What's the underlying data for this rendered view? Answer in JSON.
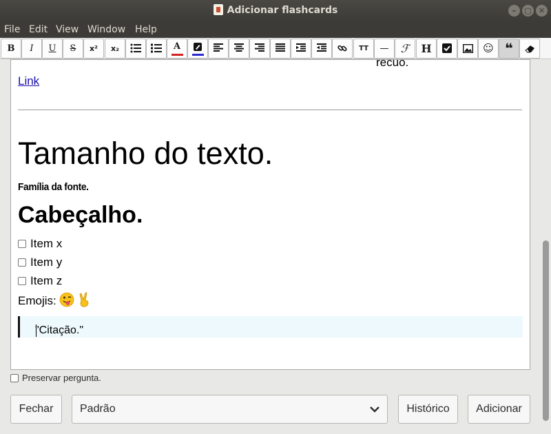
{
  "window": {
    "title": "Adicionar flashcards"
  },
  "menu": [
    "File",
    "Edit",
    "View",
    "Window",
    "Help"
  ],
  "toolbar": {
    "bold": "B",
    "italic": "I",
    "underline": "U",
    "strike": "S",
    "superscript": "x²",
    "subscript": "x₂",
    "text_color": "A",
    "heading": "H",
    "font_size": "TT",
    "hr": "—",
    "quote": "❝"
  },
  "editor": {
    "recuo_text": "recuo.",
    "link_text": "Link",
    "big_text": "Tamanho do texto.",
    "font_family_text": "Família da fonte.",
    "heading_text": "Cabeçalho.",
    "checklist": [
      "Item x",
      "Item y",
      "Item z"
    ],
    "emojis_label": "Emojis:",
    "quote_text": "\"Citação.\""
  },
  "footer": {
    "preserve_label": "Preservar pergunta.",
    "close_label": "Fechar",
    "deck_selected": "Padrão",
    "history_label": "Histórico",
    "add_label": "Adicionar"
  },
  "colors": {
    "accent_text_color": "#d42121",
    "accent_highlight": "#2b2bd0",
    "quote_background": "#eef9fd"
  }
}
